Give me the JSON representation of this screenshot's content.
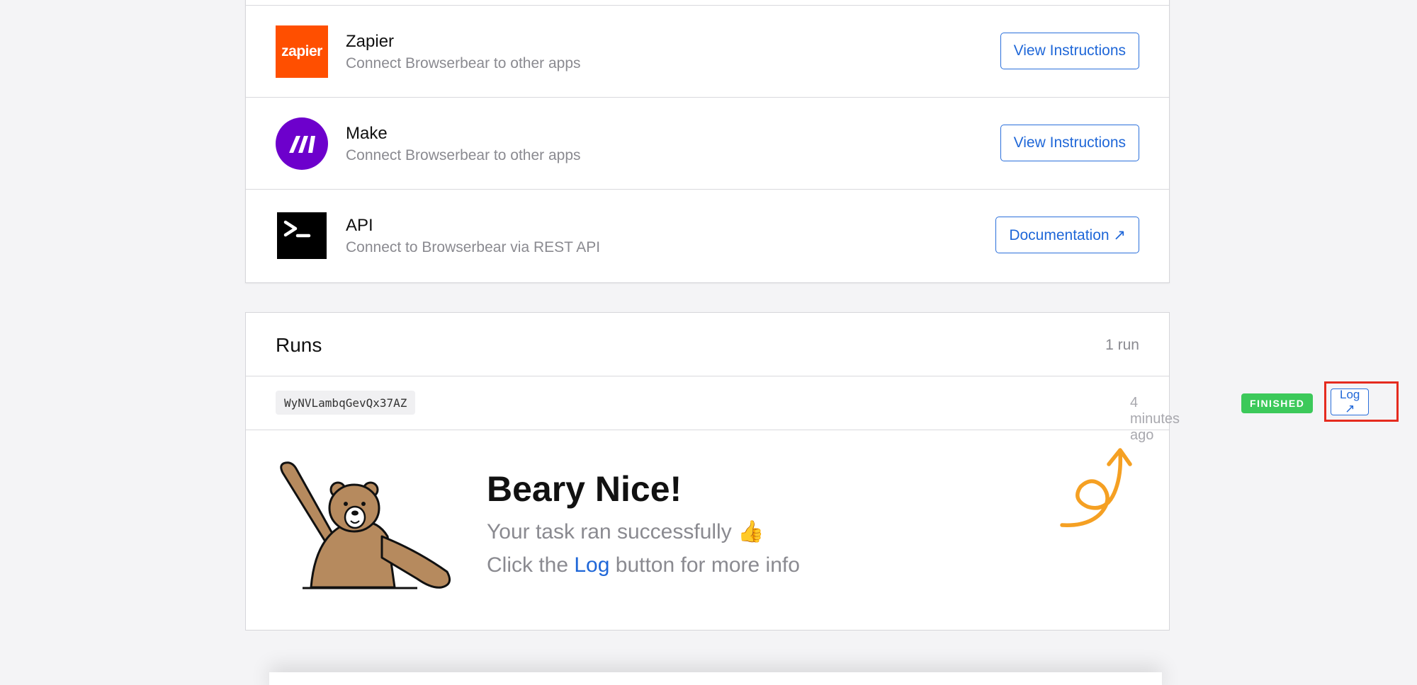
{
  "integrations": [
    {
      "name": "Zapier",
      "description": "Connect Browserbear to other apps",
      "button": "View Instructions",
      "icon": "zapier-logo",
      "logo_text": "zapier"
    },
    {
      "name": "Make",
      "description": "Connect Browserbear to other apps",
      "button": "View Instructions",
      "icon": "make-logo"
    },
    {
      "name": "API",
      "description": "Connect to Browserbear via REST API",
      "button": "Documentation ↗",
      "icon": "terminal-logo"
    }
  ],
  "runs": {
    "title": "Runs",
    "count": "1 run",
    "items": [
      {
        "id": "WyNVLambqGevQx37AZ",
        "time": "4 minutes ago",
        "status": "FINISHED",
        "log_label": "Log ↗"
      }
    ]
  },
  "success": {
    "title": "Beary Nice!",
    "line1": "Your task ran successfully 👍",
    "line2_prefix": "Click the ",
    "line2_link": "Log",
    "line2_suffix": " button for more info"
  },
  "colors": {
    "accent": "#1f67d8",
    "zapier": "#ff4f00",
    "make": "#6d00cc",
    "finished": "#3cc95a",
    "highlight": "#e52b1f",
    "arrow": "#f5a023"
  }
}
